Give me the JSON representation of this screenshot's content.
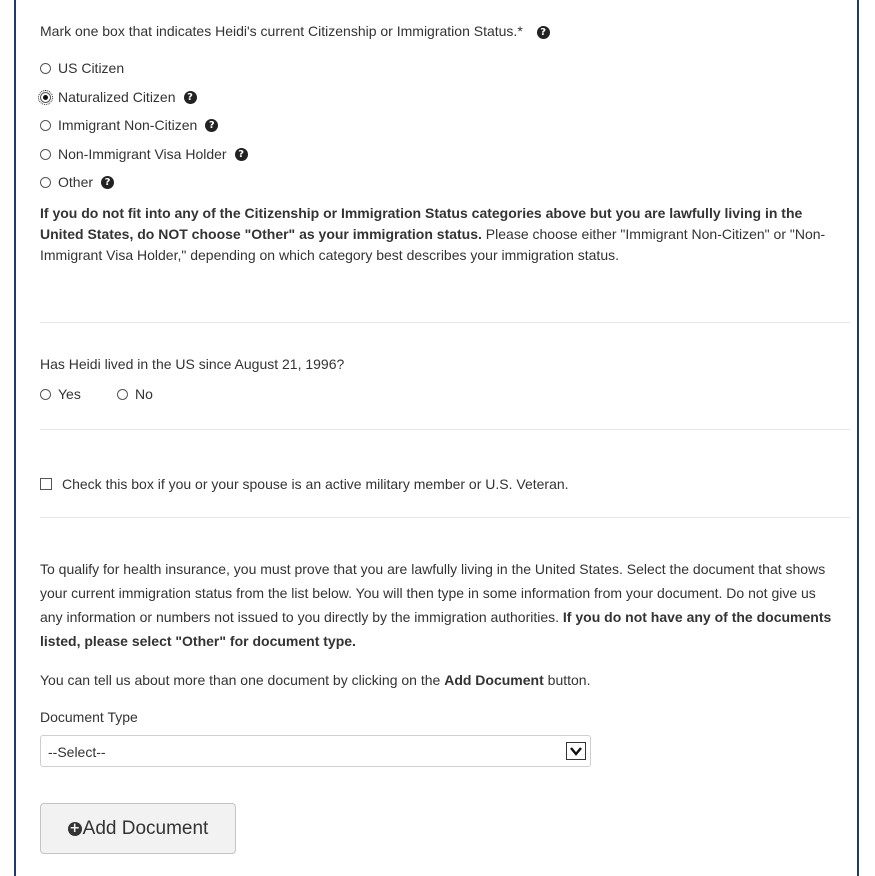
{
  "citizenship": {
    "question": "Mark one box that indicates Heidi's current Citizenship or Immigration Status.*",
    "options": [
      {
        "label": "US Citizen",
        "checked": false,
        "help": false
      },
      {
        "label": "Naturalized Citizen",
        "checked": true,
        "help": true
      },
      {
        "label": "Immigrant Non-Citizen",
        "checked": false,
        "help": true
      },
      {
        "label": "Non-Immigrant Visa Holder",
        "checked": false,
        "help": true
      },
      {
        "label": "Other",
        "checked": false,
        "help": true
      }
    ],
    "note_bold": "If you do not fit into any of the Citizenship or Immigration Status categories above but you are lawfully living in the United States, do NOT choose \"Other\" as your immigration status.",
    "note_rest": " Please choose either \"Immigrant Non-Citizen\" or \"Non-Immigrant Visa Holder,\" depending on which category best describes your immigration status."
  },
  "residence": {
    "question": "Has Heidi lived in the US since August 21, 1996?",
    "yes_label": "Yes",
    "no_label": "No"
  },
  "military": {
    "label": "Check this box if you or your spouse is an active military member or U.S. Veteran."
  },
  "documents": {
    "intro": "To qualify for health insurance, you must prove that you are lawfully living in the United States. Select the document that shows your current immigration status from the list below. You will then type in some information from your document. Do not give us any information or numbers not issued to you directly by the immigration authorities. ",
    "intro_bold": "If you do not have any of the documents listed, please select \"Other\" for document type.",
    "add_note_pre": "You can tell us about more than one document by clicking on the ",
    "add_note_bold": "Add Document",
    "add_note_post": " button.",
    "type_label": "Document Type",
    "select_value": "--Select--",
    "add_button": "Add Document"
  },
  "colors": {
    "border": "#1f3a6e",
    "text": "#333333",
    "divider": "#e6e6e6"
  }
}
